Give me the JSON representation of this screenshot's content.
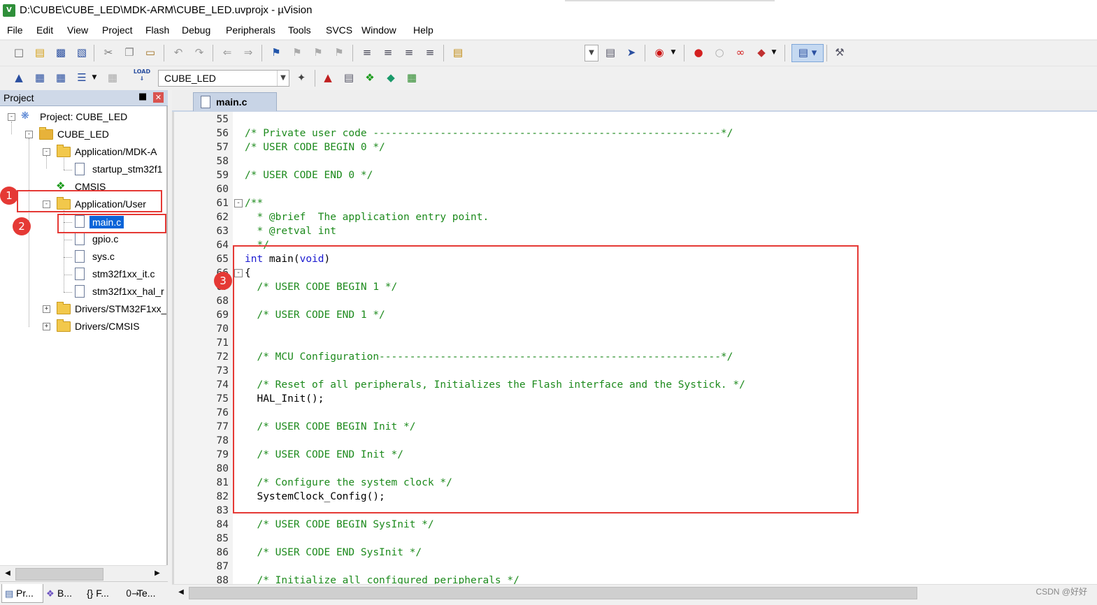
{
  "window": {
    "title": "D:\\CUBE\\CUBE_LED\\MDK-ARM\\CUBE_LED.uvprojx - µVision",
    "app_icon_text": "V"
  },
  "menu": [
    "File",
    "Edit",
    "View",
    "Project",
    "Flash",
    "Debug",
    "Peripherals",
    "Tools",
    "SVCS",
    "Window",
    "Help"
  ],
  "toolbar2": {
    "target": "CUBE_LED",
    "load_label": "LOAD"
  },
  "project_panel": {
    "title": "Project",
    "tree": [
      {
        "label": "Project: CUBE_LED",
        "type": "project"
      },
      {
        "label": "CUBE_LED",
        "type": "target"
      },
      {
        "label": "Application/MDK-A",
        "type": "folder"
      },
      {
        "label": "startup_stm32f1",
        "type": "file"
      },
      {
        "label": "CMSIS",
        "type": "component"
      },
      {
        "label": "Application/User",
        "type": "folder"
      },
      {
        "label": "main.c",
        "type": "file",
        "selected": true
      },
      {
        "label": "gpio.c",
        "type": "file"
      },
      {
        "label": "sys.c",
        "type": "file"
      },
      {
        "label": "stm32f1xx_it.c",
        "type": "file"
      },
      {
        "label": "stm32f1xx_hal_r",
        "type": "file"
      },
      {
        "label": "Drivers/STM32F1xx_",
        "type": "folder"
      },
      {
        "label": "Drivers/CMSIS",
        "type": "folder"
      }
    ],
    "bottom_tabs": [
      "Pr...",
      "B...",
      "{} F...",
      "Te..."
    ]
  },
  "editor": {
    "tab": "main.c",
    "lines": [
      {
        "n": "55",
        "parts": []
      },
      {
        "n": "56",
        "parts": [
          {
            "t": "/* Private user code ---------------------------------------------------------*/",
            "c": "comment"
          }
        ]
      },
      {
        "n": "57",
        "parts": [
          {
            "t": "/* USER CODE BEGIN 0 */",
            "c": "comment"
          }
        ]
      },
      {
        "n": "58",
        "parts": []
      },
      {
        "n": "59",
        "parts": [
          {
            "t": "/* USER CODE END 0 */",
            "c": "comment"
          }
        ]
      },
      {
        "n": "60",
        "parts": []
      },
      {
        "n": "61",
        "parts": [
          {
            "t": "/**",
            "c": "comment"
          }
        ],
        "fold": "-"
      },
      {
        "n": "62",
        "parts": [
          {
            "t": "  * @brief  The application entry point.",
            "c": "comment"
          }
        ]
      },
      {
        "n": "63",
        "parts": [
          {
            "t": "  * @retval int",
            "c": "comment"
          }
        ]
      },
      {
        "n": "64",
        "parts": [
          {
            "t": "  */",
            "c": "comment"
          }
        ]
      },
      {
        "n": "65",
        "parts": [
          {
            "t": "int",
            "c": "kw"
          },
          {
            "t": " main(",
            "c": "plain"
          },
          {
            "t": "void",
            "c": "kw"
          },
          {
            "t": ")",
            "c": "plain"
          }
        ]
      },
      {
        "n": "66",
        "parts": [
          {
            "t": "{",
            "c": "plain"
          }
        ],
        "fold": "-"
      },
      {
        "n": "67",
        "parts": [
          {
            "t": "  /* USER CODE BEGIN 1 */",
            "c": "comment"
          }
        ]
      },
      {
        "n": "68",
        "parts": []
      },
      {
        "n": "69",
        "parts": [
          {
            "t": "  /* USER CODE END 1 */",
            "c": "comment"
          }
        ]
      },
      {
        "n": "70",
        "parts": []
      },
      {
        "n": "71",
        "parts": []
      },
      {
        "n": "72",
        "parts": [
          {
            "t": "  /* MCU Configuration--------------------------------------------------------*/",
            "c": "comment"
          }
        ]
      },
      {
        "n": "73",
        "parts": []
      },
      {
        "n": "74",
        "parts": [
          {
            "t": "  /* Reset of all peripherals, Initializes the Flash interface and the Systick. */",
            "c": "comment"
          }
        ]
      },
      {
        "n": "75",
        "parts": [
          {
            "t": "  HAL_Init();",
            "c": "plain"
          }
        ]
      },
      {
        "n": "76",
        "parts": []
      },
      {
        "n": "77",
        "parts": [
          {
            "t": "  /* USER CODE BEGIN Init */",
            "c": "comment"
          }
        ]
      },
      {
        "n": "78",
        "parts": []
      },
      {
        "n": "79",
        "parts": [
          {
            "t": "  /* USER CODE END Init */",
            "c": "comment"
          }
        ]
      },
      {
        "n": "80",
        "parts": []
      },
      {
        "n": "81",
        "parts": [
          {
            "t": "  /* Configure the system clock */",
            "c": "comment"
          }
        ]
      },
      {
        "n": "82",
        "parts": [
          {
            "t": "  SystemClock_Config();",
            "c": "plain"
          }
        ]
      },
      {
        "n": "83",
        "parts": []
      },
      {
        "n": "84",
        "parts": [
          {
            "t": "  /* USER CODE BEGIN SysInit */",
            "c": "comment"
          }
        ]
      },
      {
        "n": "85",
        "parts": []
      },
      {
        "n": "86",
        "parts": [
          {
            "t": "  /* USER CODE END SysInit */",
            "c": "comment"
          }
        ]
      },
      {
        "n": "87",
        "parts": []
      },
      {
        "n": "88",
        "parts": [
          {
            "t": "  /* Initialize all configured peripherals */",
            "c": "comment"
          }
        ]
      }
    ]
  },
  "annotations": [
    "1",
    "2",
    "3"
  ],
  "watermark": "CSDN @好好",
  "colors": {
    "annotation": "#e53935",
    "comment": "#1c8a1c",
    "keyword": "#1a1ad0",
    "selection": "#0a64d8"
  }
}
